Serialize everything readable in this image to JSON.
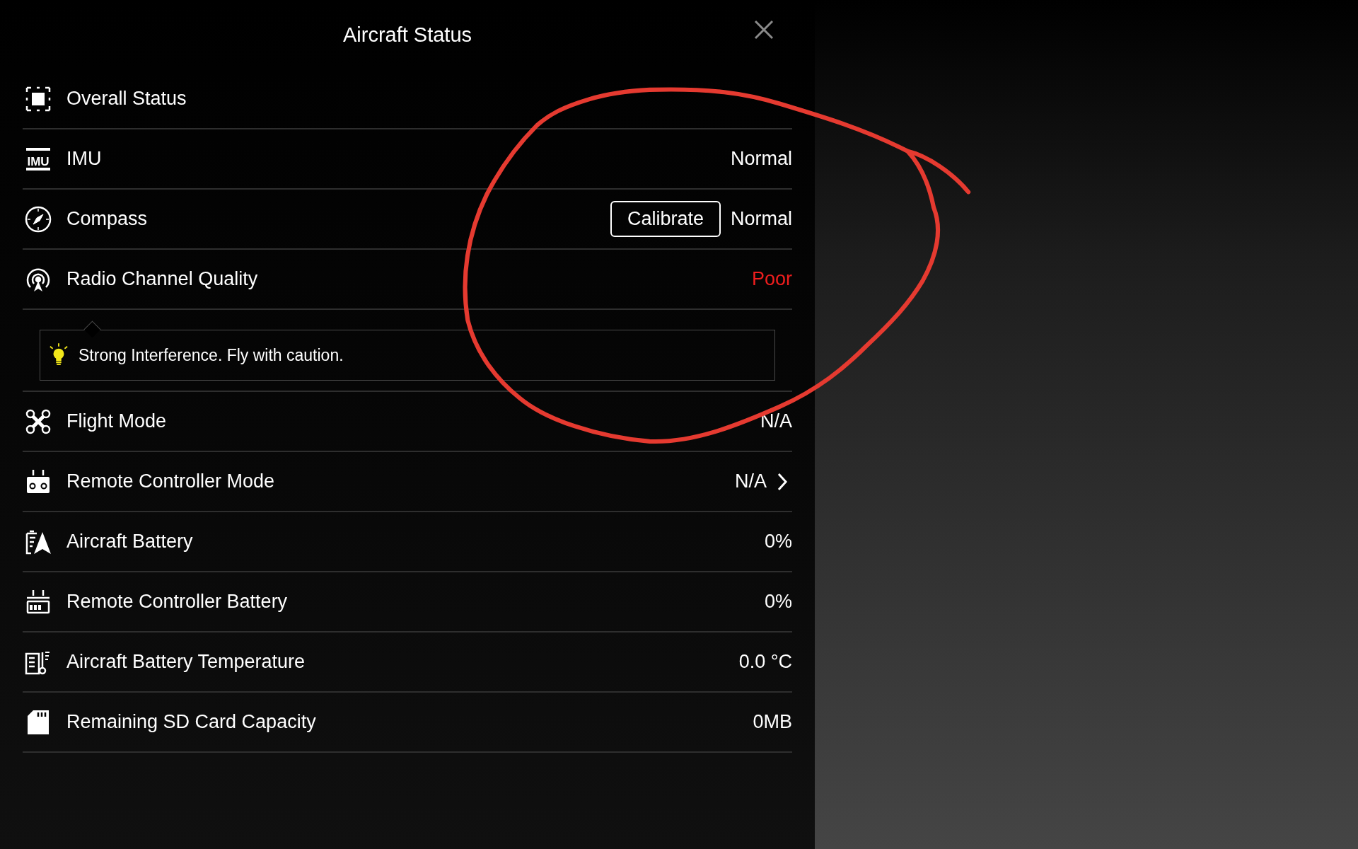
{
  "header": {
    "title": "Aircraft Status"
  },
  "rows": [
    {
      "kind": "status",
      "label": "Overall Status"
    },
    {
      "kind": "imu",
      "icon_text": "IMU",
      "label": "IMU",
      "value": "Normal",
      "alert": false
    },
    {
      "kind": "compass",
      "label": "Compass",
      "button": "Calibrate",
      "value": "Normal",
      "alert": false
    },
    {
      "kind": "radio",
      "label": "Radio Channel Quality",
      "value": "Poor",
      "alert": true,
      "tip": "Strong Interference. Fly with caution."
    },
    {
      "kind": "drone",
      "label": "Flight Mode",
      "value": "N/A",
      "alert": false
    },
    {
      "kind": "remote",
      "label": "Remote Controller Mode",
      "value": "N/A",
      "alert": false,
      "chevron": true
    },
    {
      "kind": "aircraft-battery",
      "label": "Aircraft Battery",
      "value": "0%",
      "alert": false
    },
    {
      "kind": "remote-battery",
      "label": "Remote Controller Battery",
      "value": "0%",
      "alert": false
    },
    {
      "kind": "temperature",
      "label": "Aircraft Battery Temperature",
      "value": "0.0 °C",
      "alert": false
    },
    {
      "kind": "sd",
      "label": "Remaining SD Card Capacity",
      "value": "0MB",
      "alert": false
    }
  ]
}
